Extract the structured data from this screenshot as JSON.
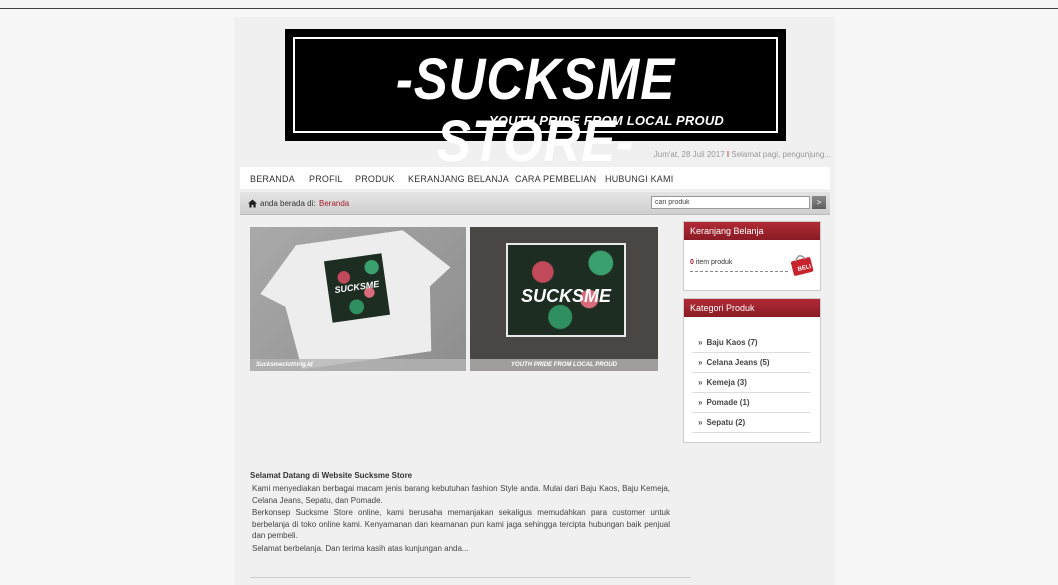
{
  "banner": {
    "title": "-SUCKSME STORE-",
    "subtitle": "YOUTH PRIDE FROM LOCAL PROUD"
  },
  "header": {
    "date": "Jum'at, 28 Juli 2017",
    "separator": "I",
    "greeting": "Selamat pagi, pengunjung..."
  },
  "nav": {
    "items": [
      "BERANDA",
      "PROFIL",
      "PRODUK",
      "KERANJANG BELANJA",
      "CARA PEMBELIAN",
      "HUBUNGI KAMI"
    ]
  },
  "breadcrumb": {
    "prefix": "anda berada di:",
    "current": "Beranda",
    "icon": "home-icon"
  },
  "search": {
    "value": "cari produk",
    "button_label": ">"
  },
  "slideshow": {
    "slides": [
      {
        "logo": "SUCKSME",
        "caption": "Sucksmeclothing.id"
      },
      {
        "logo": "SUCKSME",
        "caption": "YOUTH PRIDE FROM LOCAL PROUD"
      }
    ]
  },
  "welcome": {
    "title": "Selamat Datang di  Website Sucksme Store",
    "paragraphs": [
      "Kami menyediakan berbagai macam jenis barang kebutuhan fashion Style anda. Mulai dari Baju Kaos, Baju Kemeja, Celana Jeans, Sepatu, dan Pomade.",
      "Berkonsep Sucksme Store online, kami berusaha memanjakan sekaligus memudahkan para customer untuk berbelanja di toko online kami. Kenyamanan dan keamanan pun kami jaga sehingga tercipta hubungan baik penjual dan pembeli.",
      "Selamat berbelanja. Dan terima kasih atas kunjungan anda..."
    ]
  },
  "sidebar": {
    "cart": {
      "title": "Keranjang Belanja",
      "count": "0",
      "label": "item produk",
      "icon_text": "BELI"
    },
    "categories": {
      "title": "Kategori Produk",
      "items": [
        "Baju Kaos (7)",
        "Celana Jeans (5)",
        "Kemeja (3)",
        "Pomade (1)",
        "Sepatu (2)"
      ]
    }
  },
  "colors": {
    "accent": "#a0222a",
    "banner_bg": "#000000",
    "page_bg": "#f0f0f0"
  }
}
